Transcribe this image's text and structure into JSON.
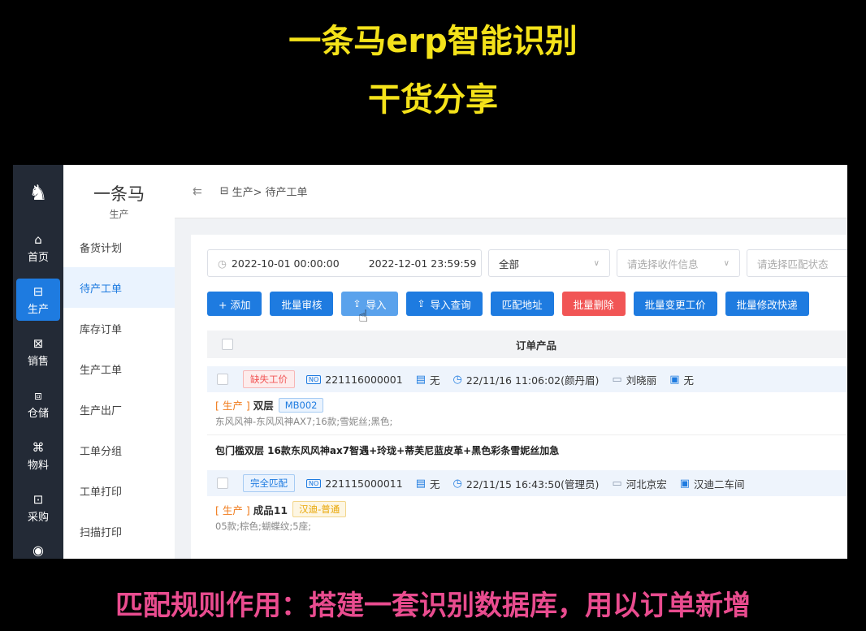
{
  "overlay": {
    "title_line1": "一条马erp智能识别",
    "title_line2": "干货分享",
    "caption": "匹配规则作用：搭建一套识别数据库，用以订单新增"
  },
  "rail": {
    "items": [
      {
        "icon": "⌂",
        "label": "首页"
      },
      {
        "icon": "⊟",
        "label": "生产",
        "active": true
      },
      {
        "icon": "⊠",
        "label": "销售"
      },
      {
        "icon": "⧈",
        "label": "仓储"
      },
      {
        "icon": "⌘",
        "label": "物料"
      },
      {
        "icon": "⊡",
        "label": "采购"
      }
    ]
  },
  "brand": {
    "name": "一条马",
    "sub": "生产"
  },
  "submenu": {
    "items": [
      "备货计划",
      "待产工单",
      "库存订单",
      "生产工单",
      "生产出厂",
      "工单分组",
      "工单打印",
      "扫描打印"
    ]
  },
  "breadcrumb": {
    "section": "生产>",
    "page": "待产工单"
  },
  "filters": {
    "date_start": "2022-10-01 00:00:00",
    "date_end": "2022-12-01 23:59:59",
    "scope": "全部",
    "receiver_placeholder": "请选择收件信息",
    "match_placeholder": "请选择匹配状态"
  },
  "actions": {
    "add": "+ 添加",
    "batch_review": "批量审核",
    "import": "导入",
    "import_query": "导入查询",
    "match_address": "匹配地址",
    "batch_delete": "批量删除",
    "batch_change_price": "批量变更工价",
    "batch_edit_express": "批量修改快递"
  },
  "table": {
    "header": "订单产品"
  },
  "orders": [
    {
      "status": "缺失工价",
      "number": "221116000001",
      "note": "无",
      "time": "22/11/16 11:06:02(颜丹眉)",
      "customer": "刘晓丽",
      "workshop": "无",
      "kind": "[ 生产 ]",
      "product": "双层",
      "code": "MB002",
      "spec": "东风风神-东风风神AX7;16款;雪妮丝;黑色;",
      "detail": "包门槛双层 16款东风风神ax7智遇+玲珑+蒂芙尼蓝皮革+黑色彩条雪妮丝加急"
    },
    {
      "status": "完全匹配",
      "number": "221115000011",
      "note": "无",
      "time": "22/11/15 16:43:50(管理员)",
      "customer": "河北京宏",
      "workshop": "汉迪二车间",
      "kind": "[ 生产 ]",
      "product": "成品11",
      "code": "汉迪-普通",
      "spec": "05款;棕色;蝴蝶纹;5座;"
    }
  ]
}
